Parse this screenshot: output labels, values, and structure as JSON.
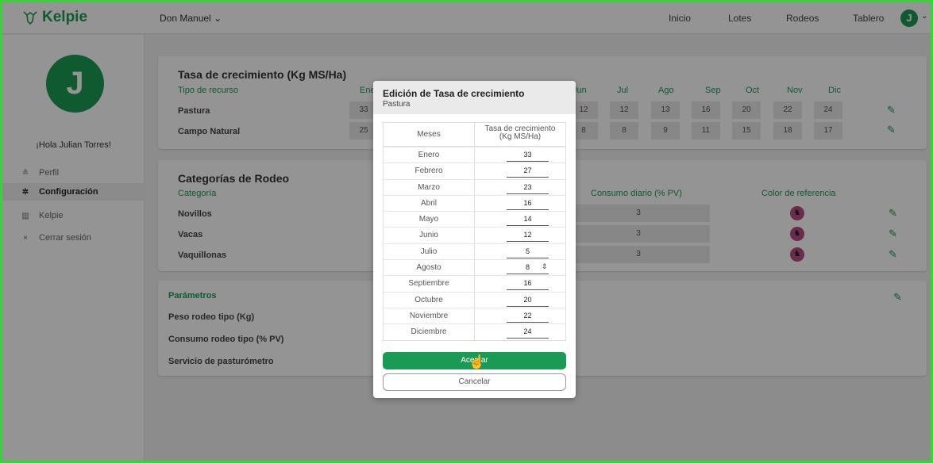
{
  "app": {
    "name": "Kelpie"
  },
  "header": {
    "user_menu": "Don Manuel",
    "nav": [
      "Inicio",
      "Lotes",
      "Rodeos",
      "Tablero"
    ],
    "avatar_initial": "J"
  },
  "sidebar": {
    "avatar_initial": "J",
    "greeting": "¡Hola Julian Torres!",
    "items": [
      {
        "label": "Perfil",
        "icon": "person-icon"
      },
      {
        "label": "Configuración",
        "icon": "gear-icon"
      },
      {
        "label": "Kelpie",
        "icon": "chart-icon"
      },
      {
        "label": "Cerrar sesión",
        "icon": "close-icon"
      }
    ]
  },
  "growth_card": {
    "title": "Tasa de crecimiento (Kg MS/Ha)",
    "col_header": "Tipo de recurso",
    "months": [
      "Ene",
      "Jun",
      "Jul",
      "Ago",
      "Sep",
      "Oct",
      "Nov",
      "Dic"
    ],
    "rows": [
      {
        "label": "Pastura",
        "values": [
          "33",
          "12",
          "12",
          "13",
          "16",
          "20",
          "22",
          "24"
        ]
      },
      {
        "label": "Campo Natural",
        "values": [
          "25",
          "8",
          "8",
          "9",
          "11",
          "15",
          "18",
          "17"
        ]
      }
    ]
  },
  "categories_card": {
    "title": "Categorías de Rodeo",
    "col_category": "Categoría",
    "col_consumo": "Consumo diario (% PV)",
    "col_color": "Color de referencia",
    "rows": [
      {
        "label": "Novillos",
        "consumo": "3"
      },
      {
        "label": "Vacas",
        "consumo": "3"
      },
      {
        "label": "Vaquillonas",
        "consumo": "3"
      }
    ]
  },
  "params_card": {
    "title": "Parámetros",
    "rows": [
      "Peso rodeo tipo (Kg)",
      "Consumo rodeo tipo (% PV)",
      "Servicio de pasturómetro"
    ]
  },
  "modal": {
    "title": "Edición de Tasa de crecimiento",
    "subtitle": "Pastura",
    "col_month": "Meses",
    "col_rate_line1": "Tasa de crecimiento",
    "col_rate_line2": "(Kg MS/Ha)",
    "rows": [
      {
        "month": "Enero",
        "value": "33"
      },
      {
        "month": "Febrero",
        "value": "27"
      },
      {
        "month": "Marzo",
        "value": "23"
      },
      {
        "month": "Abril",
        "value": "16"
      },
      {
        "month": "Mayo",
        "value": "14"
      },
      {
        "month": "Junio",
        "value": "12"
      },
      {
        "month": "Julio",
        "value": "5"
      },
      {
        "month": "Agosto",
        "value": "8"
      },
      {
        "month": "Septiembre",
        "value": "16"
      },
      {
        "month": "Octubre",
        "value": "20"
      },
      {
        "month": "Noviembre",
        "value": "22"
      },
      {
        "month": "Diciembre",
        "value": "24"
      }
    ],
    "apply_label": "Aceptar",
    "cancel_label": "Cancelar"
  },
  "colors": {
    "brand": "#1a9b55",
    "cow": "#b84b80",
    "frame": "#3cd13c"
  }
}
